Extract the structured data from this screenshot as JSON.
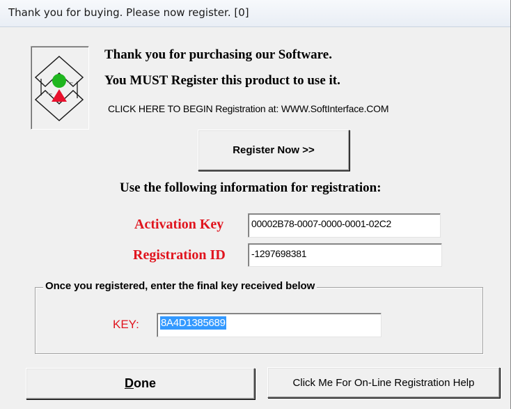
{
  "window": {
    "title": "Thank you for buying.  Please now register. [0]"
  },
  "header": {
    "line1": "Thank you for purchasing our Software.",
    "line2": "You MUST Register this product to use it.",
    "link_text": "CLICK HERE TO BEGIN Registration at: WWW.SoftInterface.COM"
  },
  "register_button": {
    "label": "Register Now >>"
  },
  "info": {
    "heading": "Use the following information for registration:",
    "activation_label": "Activation Key",
    "activation_value": "00002B78-0007-0000-0001-02C2",
    "regid_label": "Registration ID",
    "regid_value": "-1297698381"
  },
  "final_key": {
    "legend": "Once you registered, enter the final key received below",
    "key_label": "KEY:",
    "key_value": "8A4D1385689"
  },
  "footer": {
    "done_label_rest": "one",
    "done_label_mnemonic": "D",
    "help_label": "Click Me For On-Line Registration Help"
  },
  "logo": {
    "icon": "softinterface-logo-icon"
  },
  "colors": {
    "label_red": "#e0141e",
    "logo_green": "#1fb61f",
    "logo_red": "#e8112d",
    "selection_blue": "#3399ff"
  }
}
